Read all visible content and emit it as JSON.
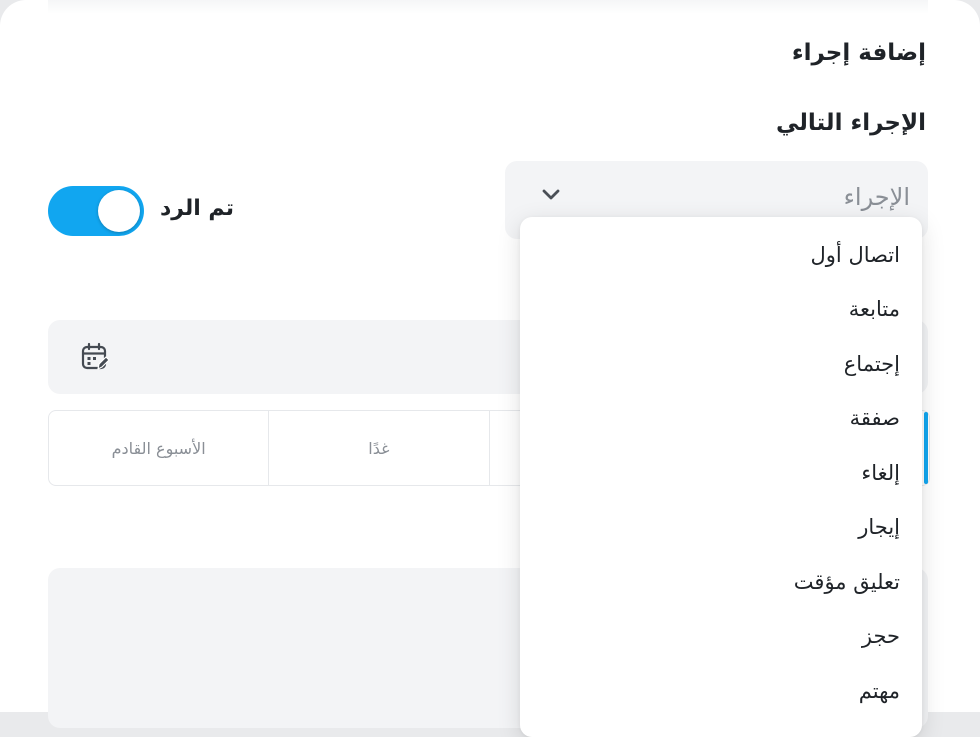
{
  "form": {
    "section_title": "إضافة إجراء",
    "next_action_label": "الإجراء التالي",
    "action_select": {
      "placeholder": "الإجراء",
      "options": [
        "اتصال أول",
        "متابعة",
        "إجتماع",
        "صفقة",
        "إلغاء",
        "إيجار",
        "تعليق مؤقت",
        "حجز",
        "مهتم"
      ]
    },
    "replied_toggle": {
      "label": "تم الرد",
      "on": true
    },
    "quick_dates": [
      "الأسبوع القادم",
      "غدًا"
    ]
  },
  "colors": {
    "accent": "#11a6f0",
    "field_background": "#f3f4f6",
    "placeholder_text": "#8a8f96"
  },
  "icons": [
    "chevron-down-icon",
    "calendar-edit-icon"
  ]
}
